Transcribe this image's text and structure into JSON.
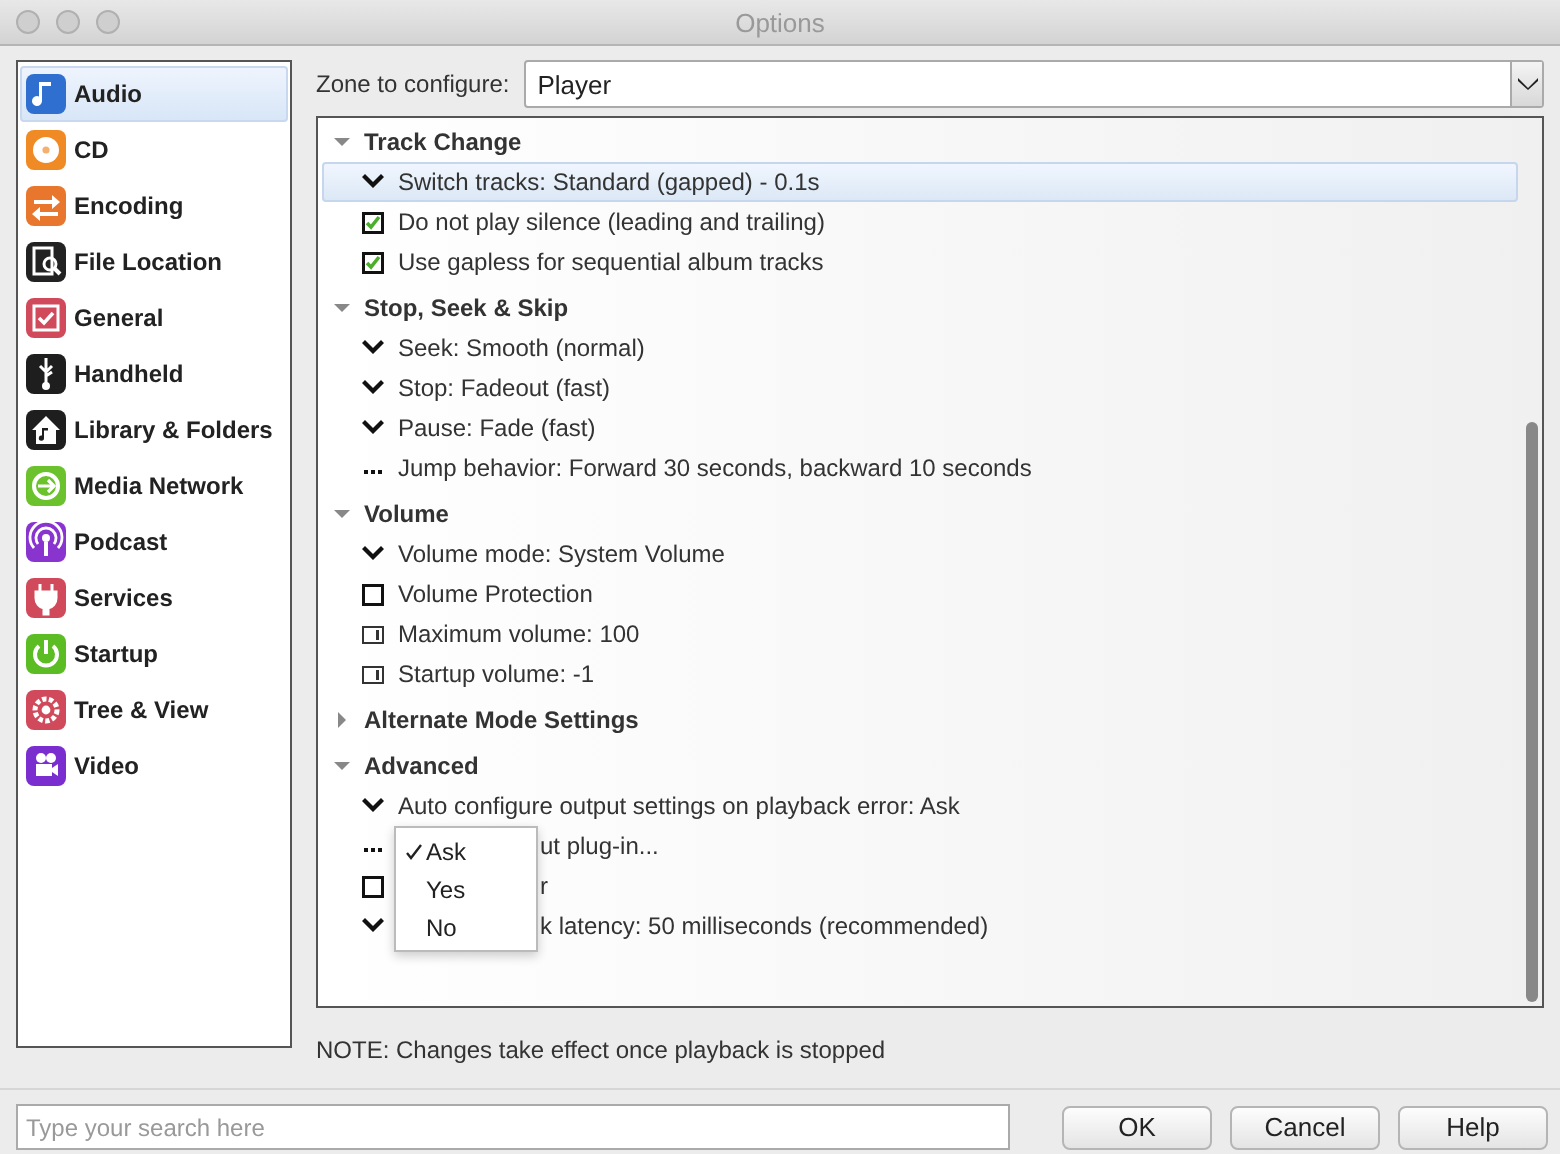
{
  "window": {
    "title": "Options"
  },
  "sidebar": {
    "items": [
      {
        "label": "Audio",
        "color": "#2f6fd0",
        "selected": true
      },
      {
        "label": "CD",
        "color": "#f08a24",
        "selected": false
      },
      {
        "label": "Encoding",
        "color": "#e8762c",
        "selected": false
      },
      {
        "label": "File Location",
        "color": "#222222",
        "selected": false
      },
      {
        "label": "General",
        "color": "#d04a5c",
        "selected": false
      },
      {
        "label": "Handheld",
        "color": "#1e1e1e",
        "selected": false
      },
      {
        "label": "Library & Folders",
        "color": "#1e1e1e",
        "selected": false
      },
      {
        "label": "Media Network",
        "color": "#6cc22c",
        "selected": false
      },
      {
        "label": "Podcast",
        "color": "#8a34d0",
        "selected": false
      },
      {
        "label": "Services",
        "color": "#d04a5c",
        "selected": false
      },
      {
        "label": "Startup",
        "color": "#5cbc24",
        "selected": false
      },
      {
        "label": "Tree & View",
        "color": "#d04a5c",
        "selected": false
      },
      {
        "label": "Video",
        "color": "#7a2ed0",
        "selected": false
      }
    ]
  },
  "zone": {
    "label": "Zone to configure:",
    "value": "Player"
  },
  "sections": [
    {
      "title": "Track Change",
      "expanded": true,
      "items": [
        {
          "kind": "dropdown",
          "label": "Switch tracks: Standard (gapped) - 0.1s",
          "selected": true
        },
        {
          "kind": "checkbox",
          "label": "Do not play silence (leading and trailing)",
          "checked": true,
          "selected": false
        },
        {
          "kind": "checkbox",
          "label": "Use gapless for sequential album tracks",
          "checked": true,
          "selected": false
        }
      ]
    },
    {
      "title": "Stop, Seek & Skip",
      "expanded": true,
      "items": [
        {
          "kind": "dropdown",
          "label": "Seek: Smooth (normal)",
          "selected": false
        },
        {
          "kind": "dropdown",
          "label": "Stop: Fadeout (fast)",
          "selected": false
        },
        {
          "kind": "dropdown",
          "label": "Pause: Fade (fast)",
          "selected": false
        },
        {
          "kind": "ellipsis",
          "label": "Jump behavior: Forward 30 seconds, backward 10 seconds",
          "selected": false
        }
      ]
    },
    {
      "title": "Volume",
      "expanded": true,
      "items": [
        {
          "kind": "dropdown",
          "label": "Volume mode: System Volume",
          "selected": false
        },
        {
          "kind": "checkbox",
          "label": "Volume Protection",
          "checked": false,
          "selected": false
        },
        {
          "kind": "number",
          "label": "Maximum volume: 100",
          "selected": false
        },
        {
          "kind": "number",
          "label": "Startup volume: -1",
          "selected": false
        }
      ]
    },
    {
      "title": "Alternate Mode Settings",
      "expanded": false
    },
    {
      "title": "Advanced",
      "expanded": true,
      "items": [
        {
          "kind": "dropdown",
          "label": "Auto configure output settings on playback error: Ask",
          "selected": false
        },
        {
          "kind": "ellipsis",
          "label": "ut plug-in...",
          "covered": true,
          "selected": false
        },
        {
          "kind": "checkbox",
          "label": "r",
          "checked": false,
          "covered": true,
          "selected": false
        },
        {
          "kind": "dropdown",
          "label": "k latency: 50 milliseconds (recommended)",
          "covered": true,
          "selected": false
        }
      ],
      "popup": {
        "options": [
          {
            "label": "Ask",
            "selected": true
          },
          {
            "label": "Yes",
            "selected": false
          },
          {
            "label": "No",
            "selected": false
          }
        ]
      }
    }
  ],
  "note": "NOTE: Changes take effect once playback is stopped",
  "search": {
    "placeholder": "Type your search here"
  },
  "buttons": [
    "OK",
    "Cancel",
    "Help"
  ]
}
